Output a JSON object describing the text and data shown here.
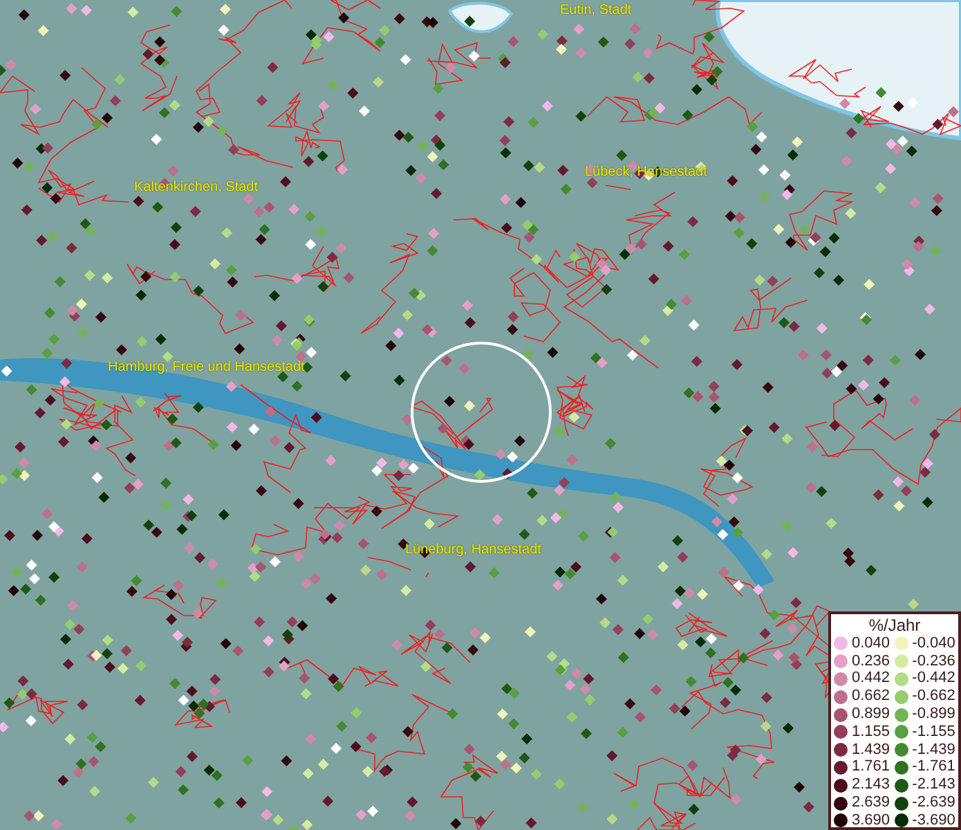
{
  "map": {
    "places": [
      {
        "name": "Eutin, Stadt"
      },
      {
        "name": "Lübeck, Hansestadt"
      },
      {
        "name": "Kaltenkirchen, Stadt"
      },
      {
        "name": "Hamburg, Freie und Hansestadt"
      },
      {
        "name": "Lüneburg, Hansestadt"
      }
    ]
  },
  "legend": {
    "title": "%/Jahr",
    "items": [
      {
        "label": "0.040",
        "color": "#f4b8e8"
      },
      {
        "label": "0.236",
        "color": "#e4a0c8"
      },
      {
        "label": "0.442",
        "color": "#d08aa8"
      },
      {
        "label": "0.662",
        "color": "#bd6f8c"
      },
      {
        "label": "0.899",
        "color": "#a85470"
      },
      {
        "label": "1.155",
        "color": "#943e58"
      },
      {
        "label": "1.439",
        "color": "#7d2a40"
      },
      {
        "label": "1.761",
        "color": "#641a2c"
      },
      {
        "label": "2.143",
        "color": "#4c0e1c"
      },
      {
        "label": "2.639",
        "color": "#360810"
      },
      {
        "label": "3.690",
        "color": "#200408"
      },
      {
        "label": "-0.040",
        "color": "#f0f4b8"
      },
      {
        "label": "-0.236",
        "color": "#d4eca0"
      },
      {
        "label": "-0.442",
        "color": "#b4dc88"
      },
      {
        "label": "-0.662",
        "color": "#94cc70"
      },
      {
        "label": "-0.899",
        "color": "#74b458"
      },
      {
        "label": "-1.155",
        "color": "#58a040"
      },
      {
        "label": "-1.439",
        "color": "#448a30"
      },
      {
        "label": "-1.761",
        "color": "#2e7222"
      },
      {
        "label": "-2.143",
        "color": "#1e5a16"
      },
      {
        "label": "-2.639",
        "color": "#12420c"
      },
      {
        "label": "-3.690",
        "color": "#082c06"
      }
    ]
  }
}
